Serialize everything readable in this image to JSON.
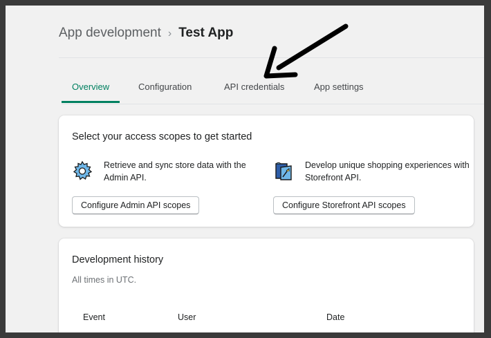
{
  "breadcrumb": {
    "parent": "App development",
    "separator": "›",
    "current": "Test App"
  },
  "tabs": [
    {
      "label": "Overview",
      "active": true
    },
    {
      "label": "Configuration",
      "active": false
    },
    {
      "label": "API credentials",
      "active": false
    },
    {
      "label": "App settings",
      "active": false
    }
  ],
  "scopes_card": {
    "title": "Select your access scopes to get started",
    "admin": {
      "icon": "gear-icon",
      "description": "Retrieve and sync store data with the Admin API.",
      "button_label": "Configure Admin API scopes"
    },
    "storefront": {
      "icon": "storefront-icon",
      "description": "Develop unique shopping experiences with Storefront API.",
      "button_label": "Configure Storefront API scopes"
    }
  },
  "history_card": {
    "title": "Development history",
    "subtitle": "All times in UTC.",
    "columns": [
      "Event",
      "User",
      "Date"
    ]
  },
  "colors": {
    "accent": "#008060",
    "annotation_arrow": "#000000"
  }
}
